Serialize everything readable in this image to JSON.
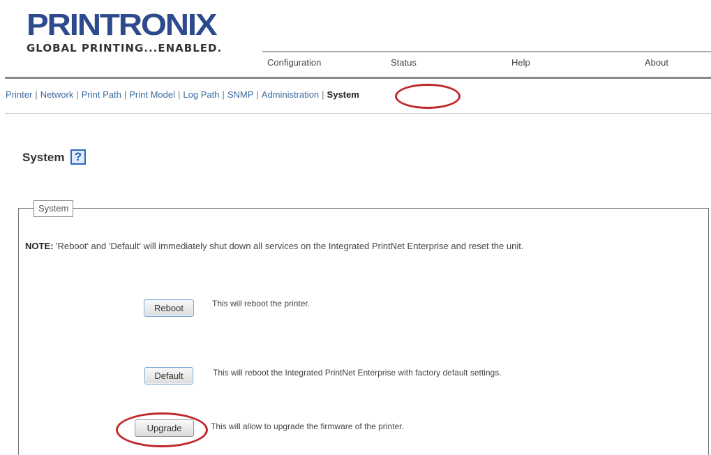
{
  "logo": {
    "brand": "PRINTRONIX",
    "tagline": "GLOBAL PRINTING...ENABLED."
  },
  "top_menu": {
    "items": [
      "Configuration",
      "Status",
      "Help",
      "About"
    ]
  },
  "sub_nav": {
    "items": [
      "Printer",
      "Network",
      "Print Path",
      "Print Model",
      "Log Path",
      "SNMP",
      "Administration",
      "System"
    ],
    "active": "System",
    "separator": "|"
  },
  "page": {
    "title": "System",
    "help_icon": "?"
  },
  "panel": {
    "legend": "System",
    "note_label": "NOTE:",
    "note_text": " 'Reboot' and 'Default' will immediately shut down all services on the Integrated PrintNet Enterprise and reset the unit."
  },
  "actions": {
    "reboot_label": "Reboot",
    "reboot_desc": "This will reboot the printer.",
    "default_label": "Default",
    "default_desc": "This will reboot the Integrated PrintNet Enterprise with factory default settings.",
    "upgrade_label": "Upgrade",
    "upgrade_desc": "This will allow to upgrade the firmware of the printer."
  },
  "colors": {
    "brand": "#2c4a8c",
    "link": "#3a6a9c",
    "highlight_circle": "#c0282a",
    "button_border": "#7aa7d8"
  },
  "icons": {
    "help": "help-icon"
  }
}
